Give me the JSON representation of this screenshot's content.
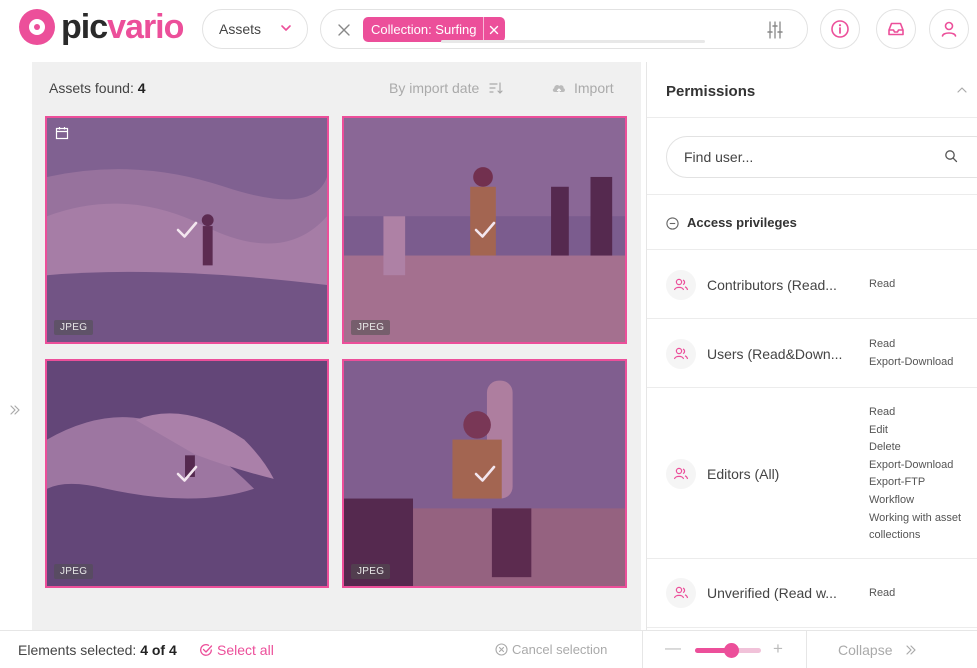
{
  "header": {
    "logo_pic": "pic",
    "logo_vario": "vario",
    "assets_select": "Assets",
    "filter_chip": "Collection: Surfing"
  },
  "main": {
    "assets_found_label": "Assets found:",
    "assets_found_count": "4",
    "sort_label": "By import date",
    "import_label": "Import",
    "tiles": [
      {
        "format": "JPEG",
        "selected": true,
        "has_calendar_icon": true
      },
      {
        "format": "JPEG",
        "selected": true
      },
      {
        "format": "JPEG",
        "selected": true
      },
      {
        "format": "JPEG",
        "selected": true
      }
    ]
  },
  "bottom": {
    "selected_label": "Elements selected:",
    "selected_count": "4 of 4",
    "select_all": "Select all",
    "cancel_selection": "Cancel selection",
    "zoom_level": 0.55,
    "collapse": "Collapse"
  },
  "panel": {
    "title": "Permissions",
    "find_placeholder": "Find user...",
    "access_title": "Access privileges",
    "groups": [
      {
        "name": "Contributors (Read...",
        "rights": [
          "Read"
        ]
      },
      {
        "name": "Users (Read&Down...",
        "rights": [
          "Read",
          "Export-Download"
        ]
      },
      {
        "name": "Editors (All)",
        "rights": [
          "Read",
          "Edit",
          "Delete",
          "Export-Download",
          "Export-FTP",
          "Workflow",
          "Working with asset",
          "collections"
        ]
      },
      {
        "name": "Unverified (Read w...",
        "rights": [
          "Read"
        ]
      }
    ]
  },
  "colors": {
    "accent": "#ec4f9a",
    "overlay": "#78286e",
    "main_bg": "#f0f0f0"
  }
}
